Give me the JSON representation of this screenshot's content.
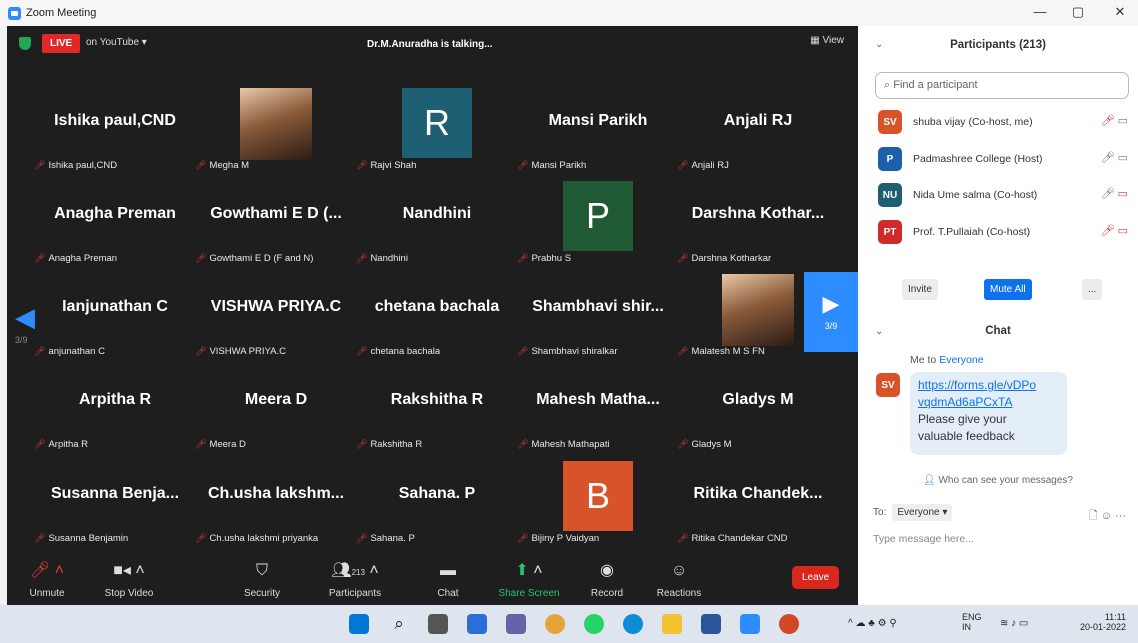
{
  "window": {
    "title": "Zoom Meeting"
  },
  "meeting": {
    "live_label": "LIVE",
    "live_target": "on YouTube ▾",
    "talking": "Dr.M.Anuradha is talking...",
    "view_label": "View"
  },
  "grid": [
    {
      "big": "Ishika paul,CND",
      "small": "Ishika paul,CND"
    },
    {
      "avatar_photo": true,
      "small": "Megha M"
    },
    {
      "avatar_letter": "R",
      "avatar_color": "#1e5f74",
      "small": "Rajvi Shah"
    },
    {
      "big": "Mansi Parikh",
      "small": "Mansi Parikh"
    },
    {
      "big": "Anjali RJ",
      "small": "Anjali RJ"
    },
    {
      "big": "Anagha Preman",
      "small": "Anagha Preman"
    },
    {
      "big": "Gowthami E D (...",
      "small": "Gowthami E D (F and N)"
    },
    {
      "big": "Nandhini",
      "small": "Nandhini"
    },
    {
      "avatar_letter": "P",
      "avatar_color": "#1f5a34",
      "small": "Prabhu S"
    },
    {
      "big": "Darshna Kothar...",
      "small": "Darshna Kotharkar"
    },
    {
      "big": "Ianjunathan C",
      "small": "anjunathan C"
    },
    {
      "big": "VISHWA PRIYA.C",
      "small": "VISHWA PRIYA.C"
    },
    {
      "big": "chetana bachala",
      "small": "chetana bachala"
    },
    {
      "big": "Shambhavi shir...",
      "small": "Shambhavi shiralkar"
    },
    {
      "avatar_photo": true,
      "small": "Malatesh M S FN"
    },
    {
      "big": "Arpitha R",
      "small": "Arpitha R"
    },
    {
      "big": "Meera D",
      "small": "Meera D"
    },
    {
      "big": "Rakshitha R",
      "small": "Rakshitha R"
    },
    {
      "big": "Mahesh Matha...",
      "small": "Mahesh Mathapati"
    },
    {
      "big": "Gladys M",
      "small": "Gladys M"
    },
    {
      "big": "Susanna Benja...",
      "small": "Susanna Benjamin"
    },
    {
      "big": "Ch.usha lakshm...",
      "small": "Ch.usha lakshmi priyanka"
    },
    {
      "big": "Sahana. P",
      "small": "Sahana. P"
    },
    {
      "avatar_letter": "B",
      "avatar_color": "#d9532a",
      "small": "Bijiny P Vaidyan"
    },
    {
      "big": "Ritika Chandek...",
      "small": "Ritika Chandekar CND"
    }
  ],
  "paging": {
    "left": "3/9",
    "right": "3/9"
  },
  "toolbar": {
    "unmute": "Unmute",
    "stop_video": "Stop Video",
    "security": "Security",
    "participants": "Participants",
    "participants_count": "213",
    "chat": "Chat",
    "share_screen": "Share Screen",
    "record": "Record",
    "reactions": "Reactions",
    "leave": "Leave"
  },
  "participants_panel": {
    "title": "Participants (213)",
    "search_placeholder": "Find a participant",
    "list": [
      {
        "initials": "SV",
        "color": "#d9532a",
        "name": "shuba vijay (Co-host, me)"
      },
      {
        "initials": "P",
        "color": "#1d5fa8",
        "name": "Padmashree College (Host)"
      },
      {
        "initials": "NU",
        "color": "#1e5f74",
        "name": "Nida Ume salma (Co-host)"
      },
      {
        "initials": "PT",
        "color": "#d02a2a",
        "name": "Prof. T.Pullaiah (Co-host)"
      }
    ],
    "invite": "Invite",
    "mute_all": "Mute All",
    "more": "..."
  },
  "chat": {
    "title": "Chat",
    "from": "Me to",
    "to": "Everyone",
    "sender_initials": "SV",
    "link_line1": "https://forms.gle/vDPo",
    "link_line2": "vqdmAd6aPCxTA",
    "text_line1": "Please give your",
    "text_line2": "valuable feedback",
    "who_can_see": "Who can see your messages?",
    "to_label": "To:",
    "to_value": "Everyone ▾",
    "input_placeholder": "Type message here..."
  },
  "taskbar": {
    "lang": "ENG",
    "region": "IN",
    "time": "11:11",
    "date": "20-01-2022"
  }
}
